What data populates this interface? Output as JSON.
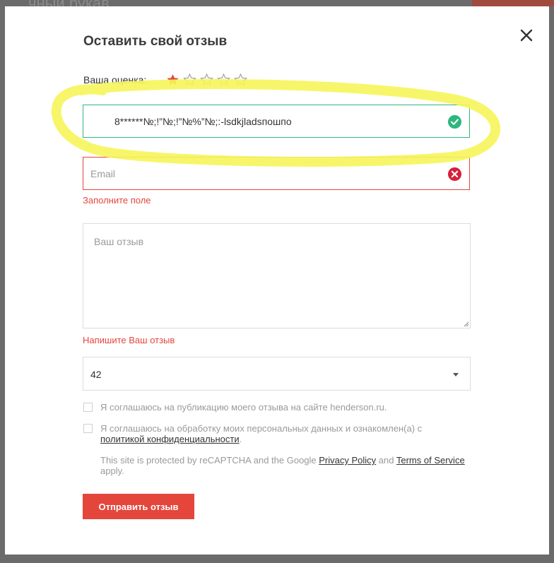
{
  "background": {
    "partial_title": "чный рукав"
  },
  "modal": {
    "title": "Оставить свой отзыв",
    "close_icon": "close-icon"
  },
  "rating": {
    "label": "Ваша оценка:",
    "value": 1,
    "max": 5,
    "filled_color": "#e4463b",
    "empty_color": "#9a9a9a"
  },
  "name_field": {
    "value": "8******№;!”№;!”№%”№;:-lsdkjladsпошпо",
    "status": "valid",
    "status_icon": "check-circle-icon"
  },
  "email_field": {
    "placeholder": "Email",
    "value": "",
    "status": "invalid",
    "status_icon": "error-circle-icon",
    "error": "Заполните поле"
  },
  "review_field": {
    "placeholder": "Ваш отзыв",
    "value": "",
    "error": "Напишите Ваш отзыв"
  },
  "size_select": {
    "value": "42"
  },
  "consents": {
    "publication": {
      "text": "Я соглашаюсь на публикацию моего отзыва на сайте henderson.ru.",
      "checked": false
    },
    "personal_data": {
      "text": "Я соглашаюсь на обработку моих персональных данных и ознакомлен(а) с",
      "link": "политикой конфиденциальности",
      "suffix": ".",
      "checked": false
    }
  },
  "recaptcha": {
    "text1": "This site is protected by reCAPTCHA and the Google ",
    "privacy_link": "Privacy Policy",
    "and": " and ",
    "terms_link": "Terms of Service",
    "apply": " apply."
  },
  "submit": {
    "label": "Отправить отзыв"
  },
  "colors": {
    "accent": "#e4463b",
    "valid": "#2eb67f",
    "highlight": "#f6f55a"
  }
}
